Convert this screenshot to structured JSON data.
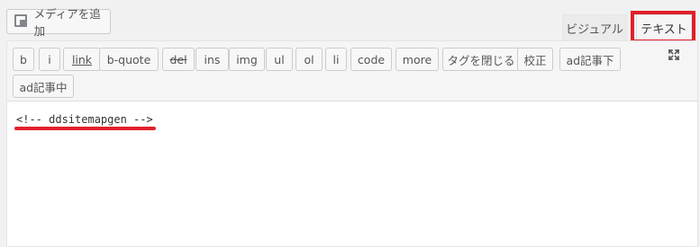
{
  "media": {
    "label": "メディアを追加",
    "icon": "add-media-icon"
  },
  "tabs": {
    "visual": "ビジュアル",
    "text": "テキスト",
    "active": "text"
  },
  "toolbar": {
    "buttons": [
      "b",
      "i",
      "link",
      "b-quote",
      "del",
      "ins",
      "img",
      "ul",
      "ol",
      "li",
      "code",
      "more",
      "タグを閉じる",
      "校正",
      "ad記事下",
      "ad記事中"
    ],
    "fullscreen_icon": "fullscreen-icon"
  },
  "content": "<!-- ddsitemapgen -->",
  "colors": {
    "annotation": "#e0202a"
  }
}
